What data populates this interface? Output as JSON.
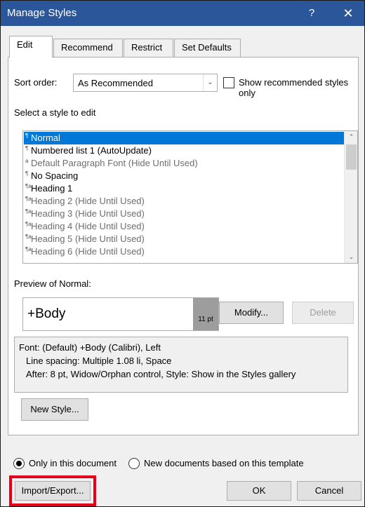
{
  "window": {
    "title": "Manage Styles",
    "help_label": "?",
    "close_label": "✕"
  },
  "tabs": [
    {
      "label": "Edit",
      "active": true
    },
    {
      "label": "Recommend",
      "active": false
    },
    {
      "label": "Restrict",
      "active": false
    },
    {
      "label": "Set Defaults",
      "active": false
    }
  ],
  "sort": {
    "label": "Sort order:",
    "value": "As Recommended",
    "show_recommended_label": "Show recommended styles only",
    "show_recommended_checked": false
  },
  "select_style_label": "Select a style to edit",
  "styles_list": [
    {
      "glyph": "¶",
      "label": "Normal",
      "selected": true,
      "hidden": false
    },
    {
      "glyph": "¶",
      "label": "Numbered list 1  (AutoUpdate)",
      "selected": false,
      "hidden": false
    },
    {
      "glyph": "a",
      "label": "Default Paragraph Font  (Hide Until Used)",
      "selected": false,
      "hidden": true
    },
    {
      "glyph": "¶",
      "label": "No Spacing",
      "selected": false,
      "hidden": false
    },
    {
      "glyph": "¶a",
      "label": "Heading 1",
      "selected": false,
      "hidden": false
    },
    {
      "glyph": "¶a",
      "label": "Heading 2  (Hide Until Used)",
      "selected": false,
      "hidden": true
    },
    {
      "glyph": "¶a",
      "label": "Heading 3  (Hide Until Used)",
      "selected": false,
      "hidden": true
    },
    {
      "glyph": "¶a",
      "label": "Heading 4  (Hide Until Used)",
      "selected": false,
      "hidden": true
    },
    {
      "glyph": "¶a",
      "label": "Heading 5  (Hide Until Used)",
      "selected": false,
      "hidden": true
    },
    {
      "glyph": "¶a",
      "label": "Heading 6  (Hide Until Used)",
      "selected": false,
      "hidden": true
    }
  ],
  "preview": {
    "label": "Preview of Normal:",
    "sample_text": "+Body",
    "size": "11 pt"
  },
  "buttons": {
    "modify": "Modify...",
    "delete": "Delete",
    "new_style": "New Style...",
    "import_export": "Import/Export...",
    "ok": "OK",
    "cancel": "Cancel"
  },
  "description": {
    "line1": "Font: (Default) +Body (Calibri), Left",
    "line2": "Line spacing:  Multiple 1.08 li, Space",
    "line3": "After:  8 pt, Widow/Orphan control, Style: Show in the Styles gallery"
  },
  "scope": {
    "only_this_document": "Only in this document",
    "new_documents": "New documents based on this template",
    "selected": "only_this_document"
  },
  "colors": {
    "titlebar": "#2b579a",
    "selection": "#0078d7",
    "highlight_box": "#e3001b"
  }
}
